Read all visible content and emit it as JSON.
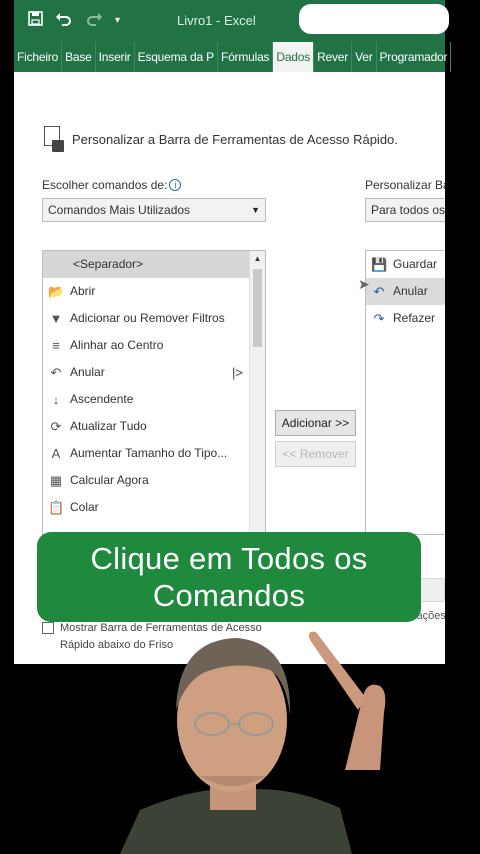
{
  "titlebar": {
    "doc_title": "Livro1 - Excel",
    "qat": {
      "save_icon": "save-icon",
      "undo_icon": "undo-icon",
      "redo_icon": "redo-icon",
      "customize_icon": "customize-qat-icon"
    }
  },
  "ribbon": {
    "tabs": [
      {
        "label": "Ficheiro",
        "active": false
      },
      {
        "label": "Base",
        "active": false
      },
      {
        "label": "Inserir",
        "active": false
      },
      {
        "label": "Esquema da P",
        "active": false
      },
      {
        "label": "Fórmulas",
        "active": false
      },
      {
        "label": "Dados",
        "active": true
      },
      {
        "label": "Rever",
        "active": false
      },
      {
        "label": "Ver",
        "active": false
      },
      {
        "label": "Programador",
        "active": false
      }
    ]
  },
  "dialog": {
    "title": "Personalizar a Barra de Ferramentas de Acesso Rápido.",
    "choose_label": "Escolher comandos de:",
    "choose_value": "Comandos Mais Utilizados",
    "customize_label": "Personalizar Barr",
    "customize_value": "Para todos os d",
    "commands": [
      {
        "label": "<Separador>",
        "icon": "separator",
        "separator": true
      },
      {
        "label": "Abrir",
        "icon": "folder-open-icon"
      },
      {
        "label": "Adicionar ou Remover Filtros",
        "icon": "filter-icon"
      },
      {
        "label": "Alinhar ao Centro",
        "icon": "align-center-icon"
      },
      {
        "label": "Anular",
        "icon": "undo-icon",
        "has_submenu": true
      },
      {
        "label": "Ascendente",
        "icon": "sort-ascending-icon"
      },
      {
        "label": "Atualizar Tudo",
        "icon": "refresh-all-icon"
      },
      {
        "label": "Aumentar Tamanho do Tipo...",
        "icon": "increase-font-icon"
      },
      {
        "label": "Calcular Agora",
        "icon": "calculator-icon"
      },
      {
        "label": "Colar",
        "icon": "paste-icon"
      }
    ],
    "add_button": "Adicionar >>",
    "remove_button": "<< Remover",
    "qat_items": [
      {
        "label": "Guardar",
        "icon": "save-icon"
      },
      {
        "label": "Anular",
        "icon": "undo-icon",
        "selected": true
      },
      {
        "label": "Refazer",
        "icon": "redo-icon"
      }
    ],
    "show_below_ribbon": "Mostrar Barra de Ferramentas de Acesso Rápido abaixo do Friso",
    "right_trailing": "zações:"
  },
  "banner": {
    "line1": "Clique em Todos os",
    "line2": "Comandos"
  },
  "colors": {
    "excel_green": "#217346",
    "banner_green": "#1f8a3e"
  }
}
